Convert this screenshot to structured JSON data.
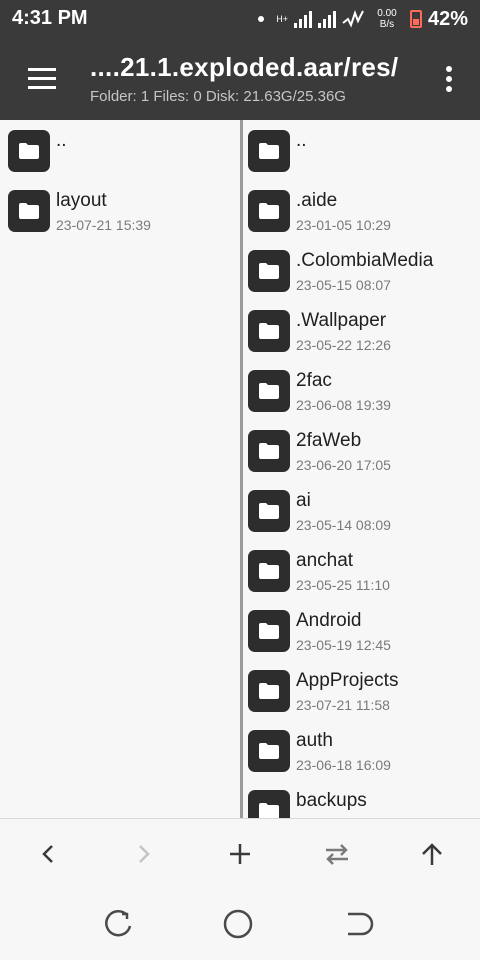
{
  "status_bar": {
    "time": "4:31 PM",
    "network_type": "H+",
    "speed_value": "0.00",
    "speed_unit": "B/s",
    "battery": "42%",
    "colors": {
      "background": "#3a3a3a",
      "battery": "#ff6b5a"
    }
  },
  "toolbar": {
    "path_title": "....21.1.exploded.aar/res/",
    "subtitle": "Folder: 1  Files: 0  Disk: 21.63G/25.36G",
    "menu_icon": "hamburger-menu-icon",
    "more_icon": "more-vert-icon"
  },
  "left_pane": {
    "items": [
      {
        "name": "..",
        "date": ""
      },
      {
        "name": "layout",
        "date": "23-07-21 15:39"
      }
    ]
  },
  "right_pane": {
    "items": [
      {
        "name": "..",
        "date": ""
      },
      {
        "name": ".aide",
        "date": "23-01-05 10:29"
      },
      {
        "name": ".ColombiaMedia",
        "date": "23-05-15 08:07"
      },
      {
        "name": ".Wallpaper",
        "date": "23-05-22 12:26"
      },
      {
        "name": "2fac",
        "date": "23-06-08 19:39"
      },
      {
        "name": "2faWeb",
        "date": "23-06-20 17:05"
      },
      {
        "name": "ai",
        "date": "23-05-14 08:09"
      },
      {
        "name": "anchat",
        "date": "23-05-25 11:10"
      },
      {
        "name": "Android",
        "date": "23-05-19 12:45"
      },
      {
        "name": "AppProjects",
        "date": "23-07-21 11:58"
      },
      {
        "name": "auth",
        "date": "23-06-18 16:09"
      },
      {
        "name": "backups",
        "date": ""
      }
    ]
  },
  "bottom_bar": {
    "buttons": [
      "back-arrow-icon",
      "forward-arrow-icon",
      "add-icon",
      "swap-panes-icon",
      "up-arrow-icon"
    ]
  },
  "nav_bar": {
    "buttons": [
      "recent-apps-icon",
      "home-icon",
      "back-icon"
    ]
  }
}
